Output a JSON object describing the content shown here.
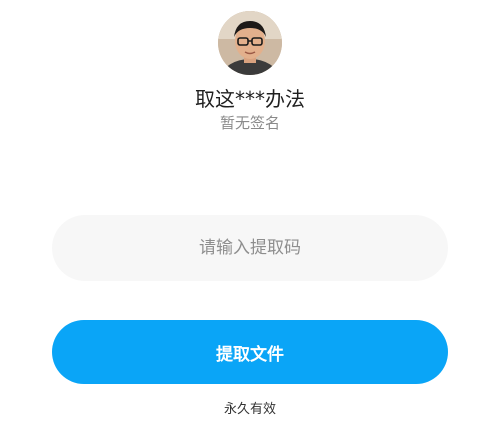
{
  "profile": {
    "avatar_icon": "user-avatar-photo",
    "username": "取这***办法",
    "signature": "暂无签名"
  },
  "form": {
    "code_placeholder": "请输入提取码",
    "code_value": "",
    "submit_label": "提取文件",
    "validity_text": "永久有效"
  },
  "colors": {
    "accent": "#0aa5f7",
    "input_bg": "#f7f7f7",
    "muted_text": "#8a8a8a"
  }
}
